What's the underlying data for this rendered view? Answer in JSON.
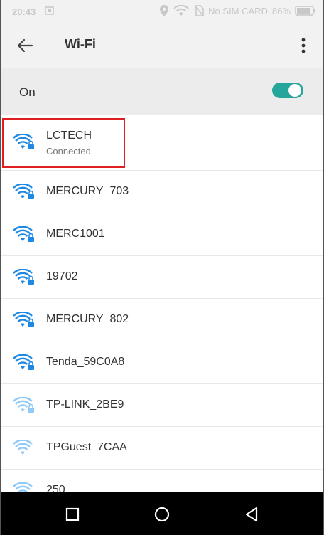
{
  "status_bar": {
    "time": "20:43",
    "sim_text": "No SIM CARD",
    "battery": "86%"
  },
  "app_bar": {
    "title": "Wi-Fi"
  },
  "toggle": {
    "label": "On",
    "state": "on",
    "color": "#26a69a"
  },
  "networks": [
    {
      "name": "LCTECH",
      "status": "Connected",
      "locked": true,
      "strength": 4
    },
    {
      "name": "MERCURY_703",
      "locked": true,
      "strength": 4
    },
    {
      "name": "MERC1001",
      "locked": true,
      "strength": 4
    },
    {
      "name": "19702",
      "locked": true,
      "strength": 4
    },
    {
      "name": "MERCURY_802",
      "locked": true,
      "strength": 4
    },
    {
      "name": "Tenda_59C0A8",
      "locked": true,
      "strength": 4
    },
    {
      "name": "TP-LINK_2BE9",
      "locked": true,
      "strength": 2
    },
    {
      "name": "TPGuest_7CAA",
      "locked": false,
      "strength": 2
    },
    {
      "name": "250",
      "locked": false,
      "strength": 2
    }
  ],
  "colors": {
    "wifi_strong": "#1e88e5",
    "wifi_weak": "#90caf9",
    "highlight": "#e02020"
  },
  "nav": {
    "icons": [
      "recent-apps-icon",
      "home-icon",
      "back-icon"
    ]
  }
}
